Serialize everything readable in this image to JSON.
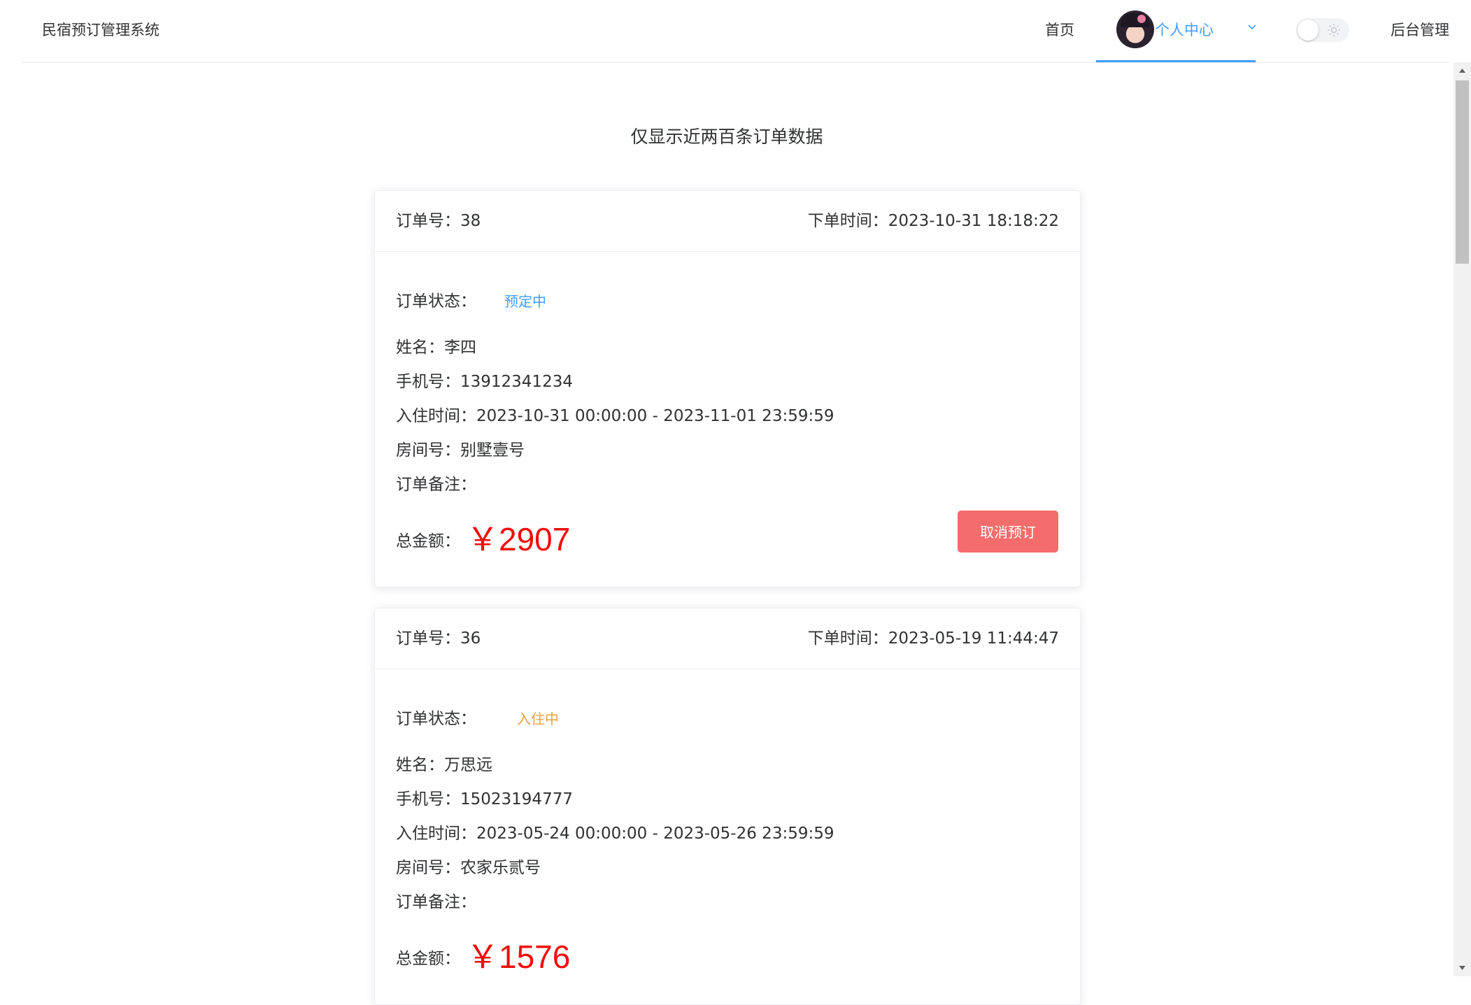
{
  "nav": {
    "brand": "民宿预订管理系统",
    "home": "首页",
    "personal_center": "个人中心",
    "admin": "后台管理"
  },
  "page": {
    "title": "仅显示近两百条订单数据"
  },
  "labels": {
    "order_id": "订单号：",
    "order_time": "下单时间：",
    "status": "订单状态：",
    "name": "姓名：",
    "phone": "手机号：",
    "checkin": "入住时间：",
    "room": "房间号：",
    "remark": "订单备注：",
    "total": "总金额：",
    "date_sep": " - ",
    "currency": "￥"
  },
  "colors": {
    "accent": "#409eff",
    "status_reserved": "#409eff",
    "status_checked_in": "#e6a23c",
    "price": "#f20c0c",
    "cancel_button": "#f56c6c"
  },
  "orders": [
    {
      "id": "38",
      "time": "2023-10-31 18:18:22",
      "status": "预定中",
      "name": "李四",
      "phone": "13912341234",
      "checkin_start": "2023-10-31 00:00:00",
      "checkin_end": "2023-11-01 23:59:59",
      "room": "别墅壹号",
      "remark": "",
      "total": "2907",
      "action": "取消预订"
    },
    {
      "id": "36",
      "time": "2023-05-19 11:44:47",
      "status": "入住中",
      "name": "万思远",
      "phone": "15023194777",
      "checkin_start": "2023-05-24 00:00:00",
      "checkin_end": "2023-05-26 23:59:59",
      "room": "农家乐贰号",
      "remark": "",
      "total": "1576"
    }
  ]
}
